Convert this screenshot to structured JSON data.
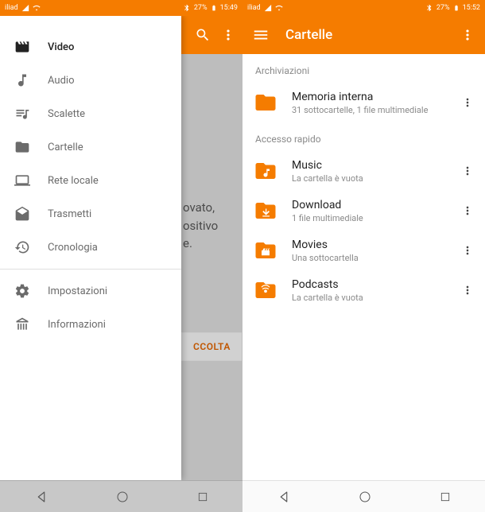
{
  "statusbar": {
    "carrier": "iliad",
    "battery": "27%",
    "time_left": "15:49",
    "time_right": "15:52"
  },
  "left": {
    "drawer": {
      "items": [
        {
          "label": "Video",
          "icon": "video-icon",
          "active": true
        },
        {
          "label": "Audio",
          "icon": "audio-icon"
        },
        {
          "label": "Scalette",
          "icon": "playlist-icon"
        },
        {
          "label": "Cartelle",
          "icon": "folder-icon"
        },
        {
          "label": "Rete locale",
          "icon": "network-icon"
        },
        {
          "label": "Trasmetti",
          "icon": "stream-icon"
        },
        {
          "label": "Cronologia",
          "icon": "history-icon"
        }
      ],
      "bottom": [
        {
          "label": "Impostazioni",
          "icon": "settings-icon"
        },
        {
          "label": "Informazioni",
          "icon": "about-icon"
        }
      ]
    },
    "bg": {
      "line1": "ovato,",
      "line2": "ositivo",
      "line3": "e.",
      "button": "CCOLTA"
    }
  },
  "right": {
    "title": "Cartelle",
    "section1": "Archiviazioni",
    "storage": {
      "title": "Memoria interna",
      "sub": "31 sottocartelle, 1 file multimediale"
    },
    "section2": "Accesso rapido",
    "quick": [
      {
        "title": "Music",
        "sub": "La cartella è vuota",
        "icon": "music"
      },
      {
        "title": "Download",
        "sub": "1 file multimediale",
        "icon": "download"
      },
      {
        "title": "Movies",
        "sub": "Una sottocartella",
        "icon": "movies"
      },
      {
        "title": "Podcasts",
        "sub": "La cartella è vuota",
        "icon": "podcasts"
      }
    ]
  }
}
